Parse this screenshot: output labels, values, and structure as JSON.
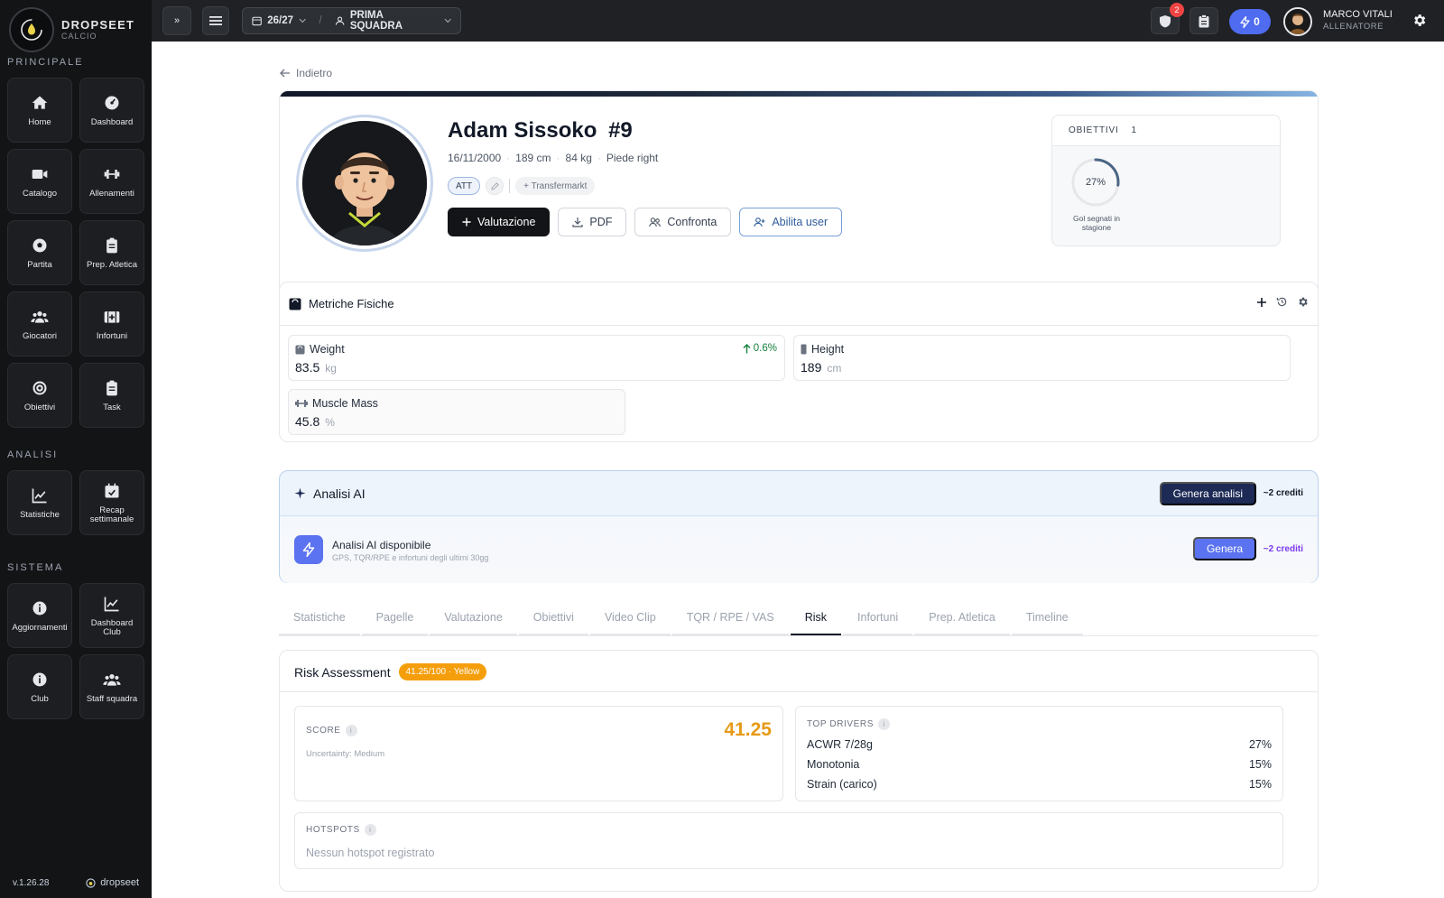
{
  "brand": {
    "name": "DROPSEET",
    "sub": "CALCIO"
  },
  "sidebar": {
    "sections": [
      {
        "title": "PRINCIPALE",
        "items": [
          {
            "label": "Home",
            "icon": "home-icon"
          },
          {
            "label": "Dashboard",
            "icon": "gauge-icon"
          },
          {
            "label": "Catalogo",
            "icon": "video-icon"
          },
          {
            "label": "Allenamenti",
            "icon": "dumbbell-icon"
          },
          {
            "label": "Partita",
            "icon": "ball-icon"
          },
          {
            "label": "Prep. Atletica",
            "icon": "clipboard-icon"
          },
          {
            "label": "Giocatori",
            "icon": "users-icon"
          },
          {
            "label": "Infortuni",
            "icon": "medkit-icon"
          },
          {
            "label": "Obiettivi",
            "icon": "target-icon"
          },
          {
            "label": "Task",
            "icon": "clipboard-icon"
          }
        ]
      },
      {
        "title": "ANALISI",
        "items": [
          {
            "label": "Statistiche",
            "icon": "chart-icon"
          },
          {
            "label": "Recap settimanale",
            "icon": "calendar-icon"
          }
        ]
      },
      {
        "title": "SISTEMA",
        "items": [
          {
            "label": "Aggiornamenti",
            "icon": "info-icon"
          },
          {
            "label": "Dashboard Club",
            "icon": "chart-icon"
          },
          {
            "label": "Club",
            "icon": "info-icon"
          },
          {
            "label": "Staff squadra",
            "icon": "users-icon"
          }
        ]
      }
    ],
    "version": "v.1.26.28",
    "footer_brand": "dropseet"
  },
  "topbar": {
    "expand_label": "»",
    "season": "26/27",
    "team": "PRIMA SQUADRA",
    "notifications_count": "2",
    "credits": "0",
    "user_name": "MARCO VITALI",
    "user_role": "ALLENATORE"
  },
  "back_label": "Indietro",
  "player": {
    "name": "Adam Sissoko",
    "number": "#9",
    "birth": "16/11/2000",
    "height": "189 cm",
    "weight": "84 kg",
    "foot": "Piede right",
    "role_tag": "ATT",
    "transfermarkt": "+ Transfermarkt",
    "actions": {
      "valutazione": "Valutazione",
      "pdf": "PDF",
      "confronta": "Confronta",
      "abilita": "Abilita user"
    }
  },
  "obiettivi": {
    "title": "OBIETTIVI",
    "count": "1",
    "goal_label": "Gol segnati in stagione",
    "progress_pct": 27,
    "progress_text": "27%"
  },
  "metrics": {
    "title": "Metriche Fisiche",
    "items": [
      {
        "label": "Weight",
        "value": "83.5",
        "unit": "kg",
        "delta": "0.6%"
      },
      {
        "label": "Height",
        "value": "189",
        "unit": "cm"
      },
      {
        "label": "Muscle Mass",
        "value": "45.8",
        "unit": "%"
      }
    ]
  },
  "ai": {
    "title": "Analisi AI",
    "generate_label": "Genera analisi",
    "credits": "~2 crediti",
    "available_title": "Analisi AI disponibile",
    "available_sub": "GPS, TQR/RPE e infortuni degli ultimi 30gg",
    "genera_label": "Genera",
    "credits2": "~2 crediti"
  },
  "tabs": [
    "Statistiche",
    "Pagelle",
    "Valutazione",
    "Obiettivi",
    "Video Clip",
    "TQR / RPE / VAS",
    "Risk",
    "Infortuni",
    "Prep. Atletica",
    "Timeline"
  ],
  "active_tab": "Risk",
  "risk": {
    "title": "Risk Assessment",
    "badge": "41.25/100 · Yellow",
    "score_label": "SCORE",
    "score_value": "41.25",
    "uncertainty": "Uncertainty: Medium",
    "drivers_label": "TOP DRIVERS",
    "drivers": [
      {
        "name": "ACWR 7/28g",
        "value": "27%"
      },
      {
        "name": "Monotonia",
        "value": "15%"
      },
      {
        "name": "Strain (carico)",
        "value": "15%"
      }
    ],
    "hotspots_label": "HOTSPOTS",
    "hotspots_empty": "Nessun hotspot registrato"
  },
  "colors": {
    "accent_blue": "#4f6cf0",
    "risk_yellow": "#f59e0b",
    "sidebar_bg": "#131416"
  }
}
